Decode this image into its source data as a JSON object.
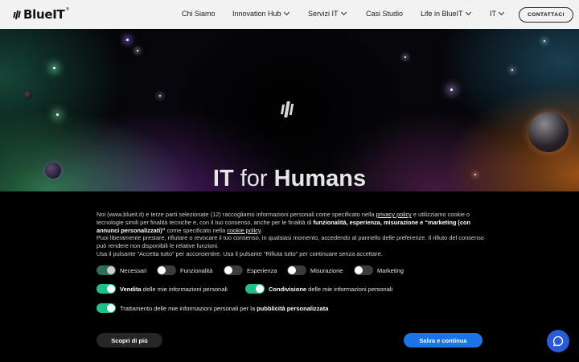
{
  "header": {
    "logo_text": "BlueIT",
    "logo_mark": "®",
    "nav": [
      {
        "label": "Chi Siamo",
        "dropdown": false
      },
      {
        "label": "Innovation Hub",
        "dropdown": true
      },
      {
        "label": "Servizi IT",
        "dropdown": true
      },
      {
        "label": "Casi Studio",
        "dropdown": false
      },
      {
        "label": "Life in BlueIT",
        "dropdown": true
      },
      {
        "label": "IT",
        "dropdown": true
      }
    ],
    "contact_label": "CONTATTACI"
  },
  "hero": {
    "title_bold_1": "IT",
    "title_mid": " for ",
    "title_bold_2": "Humans"
  },
  "cookie": {
    "p1_a": "Noi (www.blueit.it) e terze parti selezionate (12) raccogliamo informazioni personali come specificato nella ",
    "p1_link": "privacy policy",
    "p1_b": " e utilizziamo cookie o tecnologie simili per finalità tecniche e, con il tuo consenso, anche per le finalità di ",
    "p1_bold": "funzionalità, esperienza, misurazione e “marketing (con annunci personalizzati)”",
    "p1_c": " come specificato nella ",
    "p1_link2": "cookie policy",
    "p1_d": ".",
    "p2": "Puoi liberamente prestare, rifiutare o revocare il tuo consenso, in qualsiasi momento, accedendo al pannello delle preferenze. Il rifiuto del consenso può rendere non disponibili le relative funzioni.",
    "p3": "Usa il pulsante “Accetta tutto” per acconsentire. Usa il pulsante “Rifiuta tutto” per continuare senza accettare.",
    "toggles_row1": [
      {
        "label": "Necessari",
        "state": "locked"
      },
      {
        "label": "Funzionalità",
        "state": "off"
      },
      {
        "label": "Esperienza",
        "state": "off"
      },
      {
        "label": "Misurazione",
        "state": "off"
      },
      {
        "label": "Marketing",
        "state": "off"
      }
    ],
    "toggle_sell_bold": "Vendita",
    "toggle_sell_rest": " delle mie informazioni personali",
    "toggle_share_bold": "Condivisione",
    "toggle_share_rest": " delle mie informazioni personali",
    "toggle_ads_rest": "Trattamento delle mie informazioni personali per la ",
    "toggle_ads_bold": "pubblicità personalizzata",
    "more_label": "Scopri di più",
    "save_label": "Salva e continua"
  },
  "chat": {
    "icon": "chat-bubble-icon"
  },
  "colors": {
    "accent": "#1b73e8",
    "toggle_on": "#1fbf8a",
    "header_bg": "#f2f2f3"
  }
}
